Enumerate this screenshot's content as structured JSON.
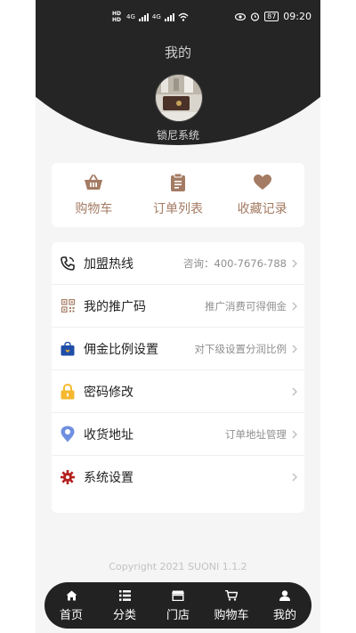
{
  "status_bar": {
    "hd1": "HD",
    "hd2": "HD",
    "net1": "4G",
    "net2": "4G",
    "battery": "87",
    "time": "09:20"
  },
  "header": {
    "title": "我的",
    "username": "锁尼系统"
  },
  "quick_actions": [
    {
      "label": "购物车",
      "icon": "basket-icon"
    },
    {
      "label": "订单列表",
      "icon": "clipboard-icon"
    },
    {
      "label": "收藏记录",
      "icon": "heart-icon"
    }
  ],
  "menu": [
    {
      "label": "加盟热线",
      "detail": "咨询：400-7676-788",
      "icon": "phone-icon"
    },
    {
      "label": "我的推广码",
      "detail": "推广消费可得佣金",
      "icon": "qrcode-icon"
    },
    {
      "label": "佣金比例设置",
      "detail": "对下级设置分润比例",
      "icon": "bag-icon"
    },
    {
      "label": "密码修改",
      "detail": "",
      "icon": "lock-icon"
    },
    {
      "label": "收货地址",
      "detail": "订单地址管理",
      "icon": "location-pin-icon"
    },
    {
      "label": "系统设置",
      "detail": "",
      "icon": "gear-icon"
    }
  ],
  "copyright": "Copyright 2021 SUONI 1.1.2",
  "tabbar": [
    {
      "label": "首页",
      "icon": "home-icon"
    },
    {
      "label": "分类",
      "icon": "list-icon"
    },
    {
      "label": "门店",
      "icon": "store-icon"
    },
    {
      "label": "购物车",
      "icon": "cart-icon"
    },
    {
      "label": "我的",
      "icon": "user-icon"
    }
  ],
  "colors": {
    "header_bg": "#252525",
    "accent_brown": "#a47b63",
    "tab_bg": "#222222",
    "bag_blue": "#1f4ea8",
    "lock_yellow": "#f5b82e",
    "pin_blue": "#6f8fe0",
    "gear_red": "#b3201e"
  }
}
